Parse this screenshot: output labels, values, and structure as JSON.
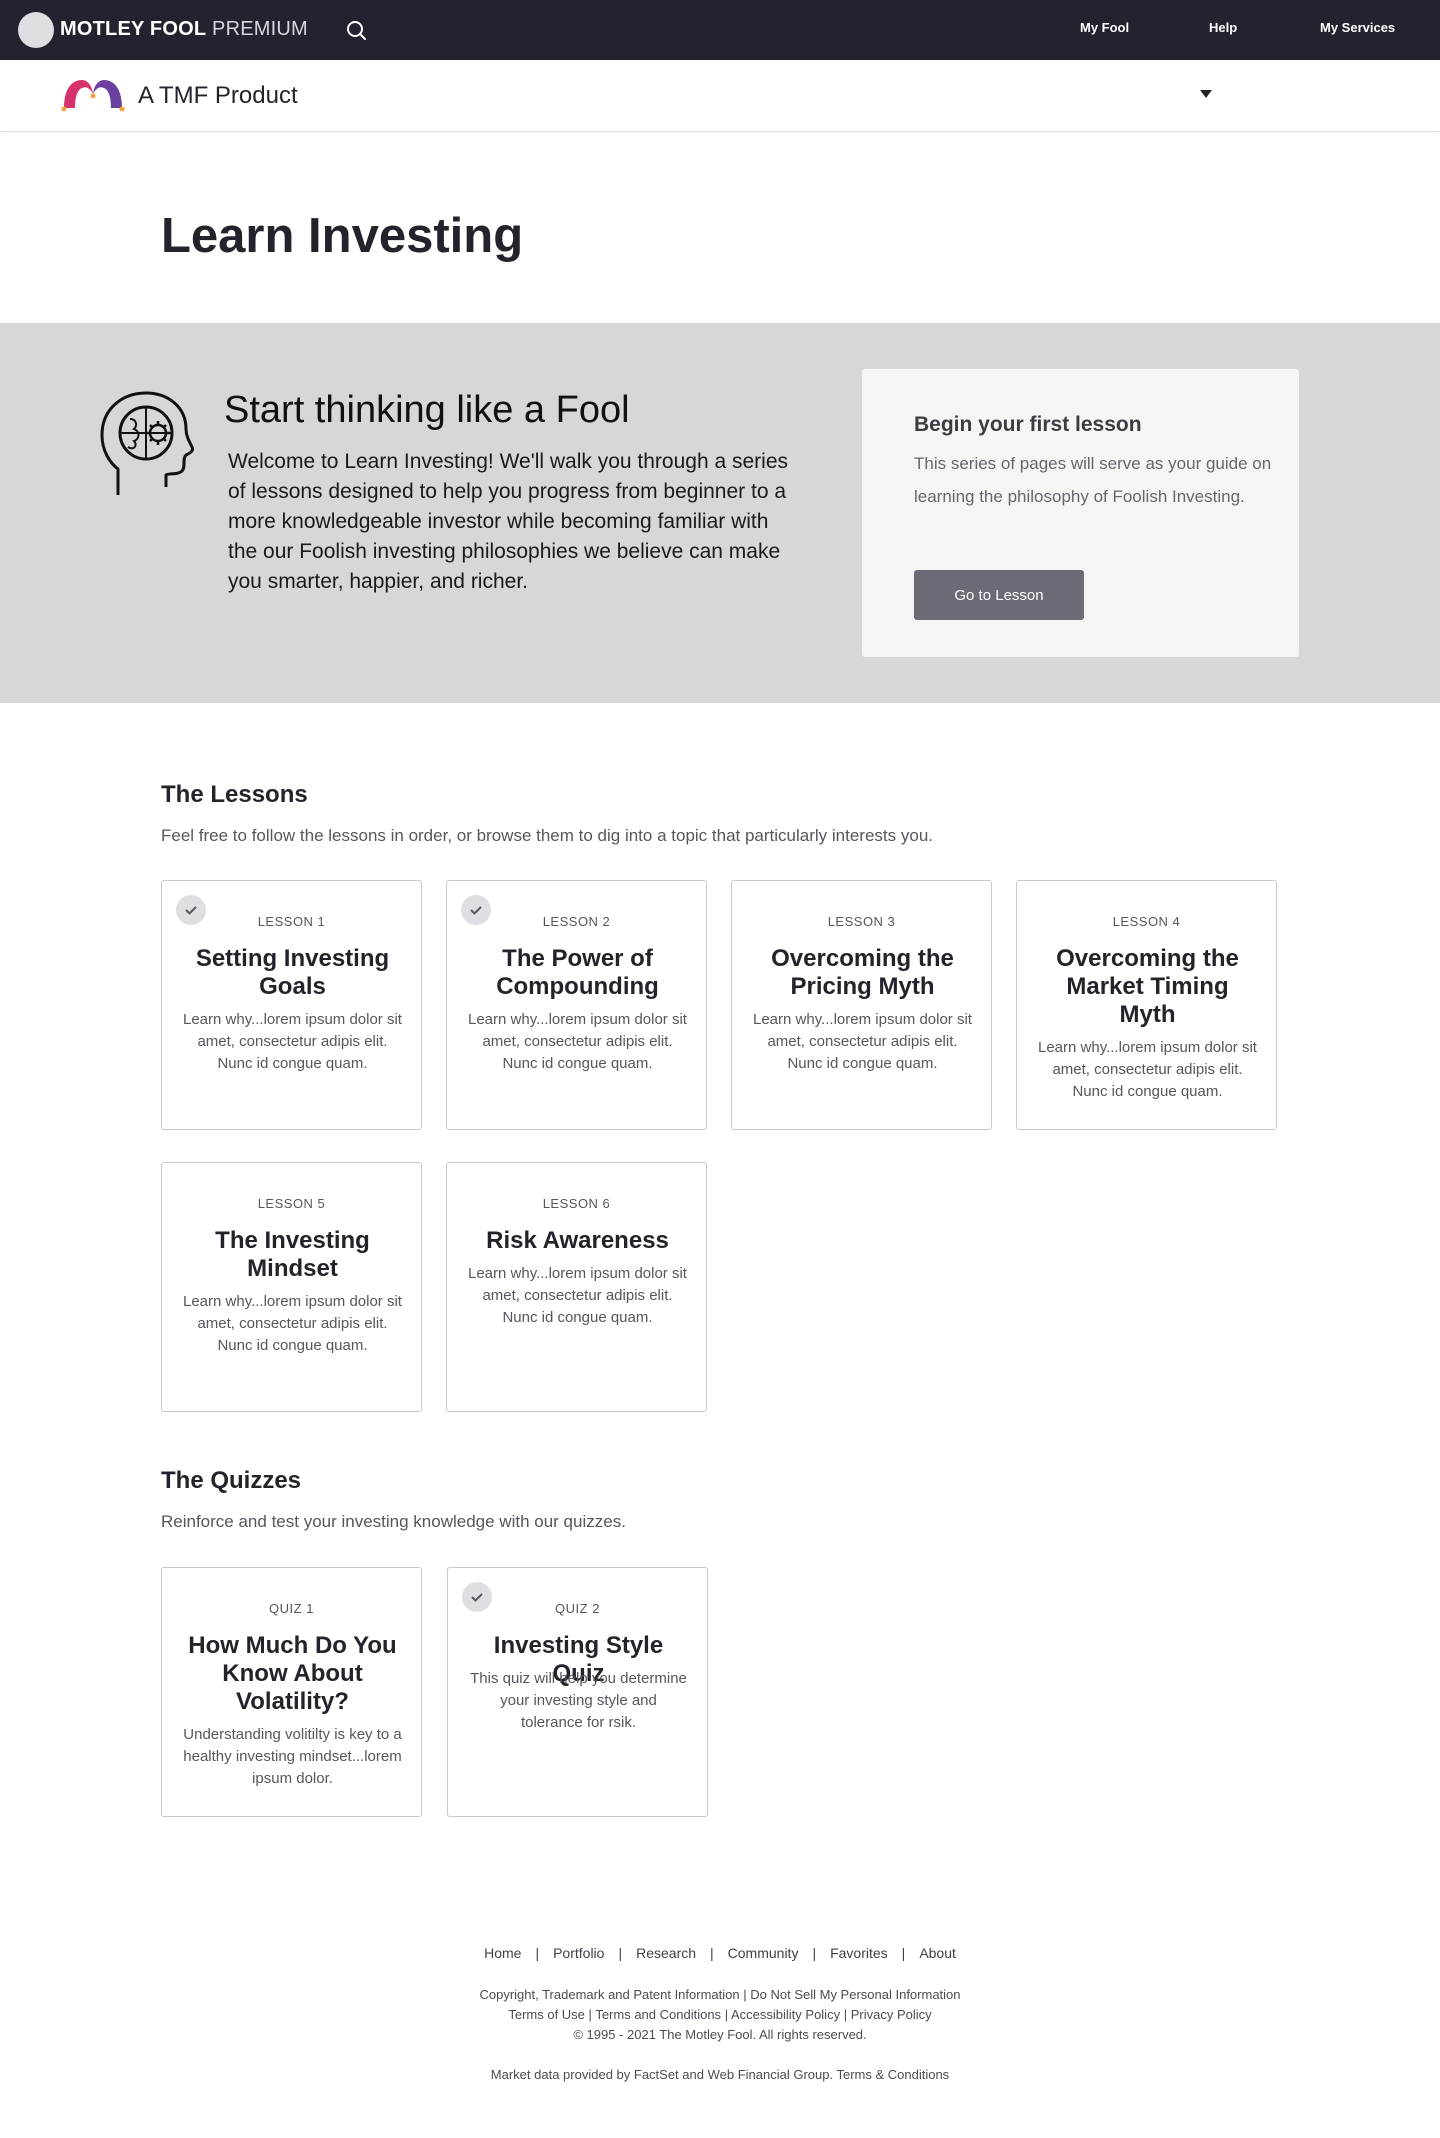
{
  "topnav": {
    "brand_bold": "MOTLEY FOOL",
    "brand_light": "PREMIUM",
    "links": [
      "My Fool",
      "Help",
      "My Services"
    ]
  },
  "product": {
    "name": "A TMF Product"
  },
  "page": {
    "title": "Learn Investing"
  },
  "hero": {
    "title": "Start thinking like a Fool",
    "text": "Welcome to Learn Investing! We'll walk you through a series of lessons designed to help you progress from beginner to a more knowledgeable investor while becoming familiar with the our Foolish investing philosophies we believe can make you smarter, happier, and richer.",
    "card": {
      "title": "Begin your first lesson",
      "text": "This series of pages will serve as your guide on learning the philosophy of Foolish Investing.",
      "button": "Go to Lesson"
    }
  },
  "lessons": {
    "title": "The Lessons",
    "subtitle": "Feel free to follow the lessons in order, or browse them to dig into a topic that particularly interests you.",
    "items": [
      {
        "eyebrow": "LESSON 1",
        "title": "Setting Investing Goals",
        "desc": "Learn why...lorem ipsum dolor sit amet, consectetur adipis elit. Nunc id congue quam.",
        "completed": true
      },
      {
        "eyebrow": "LESSON 2",
        "title": "The Power of Compounding",
        "desc": "Learn why...lorem ipsum dolor sit amet, consectetur adipis elit. Nunc id congue quam.",
        "completed": true
      },
      {
        "eyebrow": "LESSON 3",
        "title": "Overcoming the Pricing Myth",
        "desc": "Learn why...lorem ipsum dolor sit amet, consectetur adipis elit. Nunc id congue quam.",
        "completed": false
      },
      {
        "eyebrow": "LESSON 4",
        "title": "Overcoming the Market Timing Myth",
        "desc": "Learn why...lorem ipsum dolor sit amet, consectetur adipis elit. Nunc id congue quam.",
        "completed": false
      },
      {
        "eyebrow": "LESSON 5",
        "title": "The Investing Mindset",
        "desc": "Learn why...lorem ipsum dolor sit amet, consectetur adipis elit. Nunc id congue quam.",
        "completed": false
      },
      {
        "eyebrow": "LESSON 6",
        "title": "Risk Awareness",
        "desc": "Learn why...lorem ipsum dolor sit amet, consectetur adipis elit. Nunc id congue quam.",
        "completed": false
      }
    ]
  },
  "quizzes": {
    "title": "The Quizzes",
    "subtitle": "Reinforce and test your investing knowledge with our quizzes.",
    "items": [
      {
        "eyebrow": "QUIZ 1",
        "title": "How Much Do You Know About Volatility?",
        "desc": "Understanding volitilty is key to a healthy investing mindset...lorem ipsum dolor.",
        "completed": false
      },
      {
        "eyebrow": "QUIZ 2",
        "title": "Investing Style Quiz",
        "desc": "This quiz will help you determine your investing style and tolerance for rsik.",
        "completed": true
      }
    ]
  },
  "footer": {
    "links": [
      "Home",
      "Portfolio",
      "Research",
      "Community",
      "Favorites",
      "About"
    ],
    "separator": "|",
    "legal_line1": [
      "Copyright, Trademark and Patent Information",
      "Do Not Sell My Personal Information"
    ],
    "legal_line2": [
      "Terms of Use",
      "Terms and Conditions",
      "Accessibility Policy",
      "Privacy Policy"
    ],
    "copyright": "© 1995 - 2021 The Motley Fool. All rights reserved.",
    "market_data": "Market data provided by FactSet and Web Financial Group.",
    "market_terms": "Terms & Conditions"
  },
  "colors": {
    "nav_bg": "#22232e",
    "hero_bg": "#d7d7d8",
    "button_bg": "#6a6b75",
    "logo_pink": "#d6336c",
    "logo_purple": "#6b3fa0",
    "logo_orange": "#f2a33a"
  },
  "icons": {
    "search": "search-icon",
    "dropdown": "caret-down-icon",
    "brain": "brain-gear-head-icon",
    "check": "checkmark-icon"
  }
}
